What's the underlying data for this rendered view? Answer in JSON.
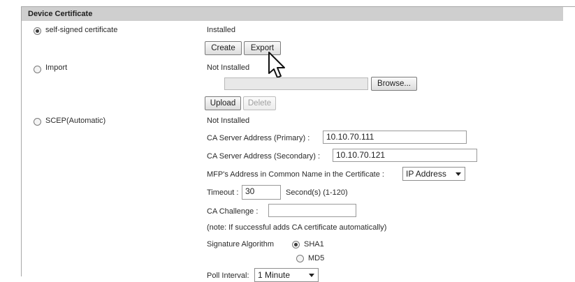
{
  "section": {
    "title": "Device Certificate"
  },
  "self_signed": {
    "label": "self-signed certificate",
    "status": "Installed",
    "create_label": "Create",
    "export_label": "Export"
  },
  "import": {
    "label": "Import",
    "status": "Not Installed",
    "file_value": "",
    "browse_label": "Browse...",
    "upload_label": "Upload",
    "delete_label": "Delete"
  },
  "scep": {
    "label": "SCEP(Automatic)",
    "status": "Not Installed",
    "ca_primary_label": "CA Server Address (Primary) :",
    "ca_primary_value": "10.10.70.111",
    "ca_secondary_label": "CA Server Address (Secondary) :",
    "ca_secondary_value": "10.10.70.121",
    "mfp_label": "MFP's Address in Common Name in the Certificate :",
    "mfp_value": "IP Address",
    "timeout_label": "Timeout :",
    "timeout_value": "30",
    "timeout_unit": "Second(s) (1-120)",
    "challenge_label": "CA Challenge :",
    "challenge_value": "",
    "note": "(note: If successful adds CA certificate automatically)",
    "sig_label": "Signature Algorithm",
    "sig_options": [
      "SHA1",
      "MD5"
    ],
    "poll_label": "Poll Interval:",
    "poll_value": "1 Minute"
  }
}
